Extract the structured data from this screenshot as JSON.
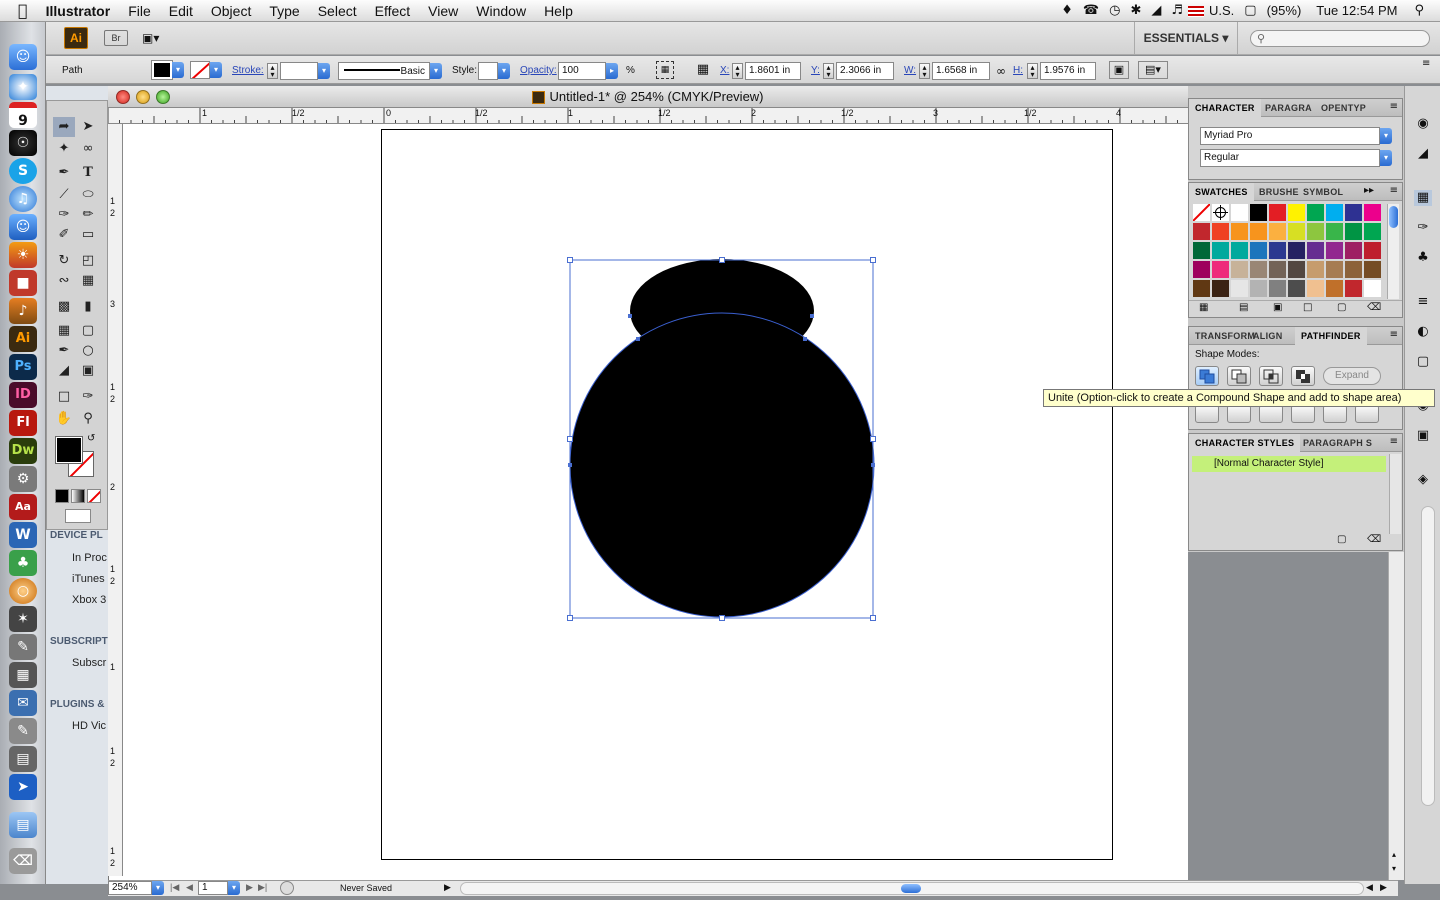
{
  "menubar": {
    "app_name": "Illustrator",
    "menus": [
      "File",
      "Edit",
      "Object",
      "Type",
      "Select",
      "Effect",
      "View",
      "Window",
      "Help"
    ],
    "input_locale": "U.S.",
    "battery": "(95%)",
    "clock": "Tue 12:54 PM"
  },
  "appbar": {
    "logo": "Ai",
    "bridge": "Br",
    "workspace": "ESSENTIALS"
  },
  "control": {
    "selection_type": "Path",
    "stroke_label": "Stroke:",
    "brush_label": "Basic",
    "style_label": "Style:",
    "opacity_label": "Opacity:",
    "opacity_value": "100",
    "opacity_unit": "%",
    "x_label": "X:",
    "x_value": "1.8601 in",
    "y_label": "Y:",
    "y_value": "2.3066 in",
    "w_label": "W:",
    "w_value": "1.6568 in",
    "h_label": "H:",
    "h_value": "1.9576 in"
  },
  "document": {
    "title": "Untitled-1* @ 254% (CMYK/Preview)"
  },
  "hruler_labels": [
    "1",
    "1/2",
    "0",
    "1/2",
    "1",
    "1/2",
    "2",
    "1/2",
    "3",
    "1/2",
    "4"
  ],
  "vruler_labels": [
    "1",
    "2",
    "3",
    "1",
    "2",
    "2",
    "1",
    "2",
    "1",
    "1",
    "2",
    "1",
    "2",
    "0"
  ],
  "status": {
    "zoom": "254%",
    "artboard_num": "1",
    "save_state": "Never Saved"
  },
  "sidebar_left": {
    "device_header": "DEVICE PL",
    "device_items": [
      "In Proc",
      "iTunes",
      "Xbox 3"
    ],
    "subs_header": "SUBSCRIPT",
    "subs_items": [
      "Subscr"
    ],
    "plugins_header": "PLUGINS &",
    "plugins_items": [
      "HD Vic"
    ]
  },
  "character_panel": {
    "tabs": [
      "CHARACTER",
      "PARAGRA",
      "OPENTYP"
    ],
    "font_family": "Myriad Pro",
    "font_style": "Regular"
  },
  "swatches_panel": {
    "tabs": [
      "SWATCHES",
      "BRUSHE",
      "SYMBOL"
    ],
    "colors": [
      "#ffffff",
      "#ffffff",
      "#ffffff",
      "#000000",
      "#e31e24",
      "#fff200",
      "#00a651",
      "#00aeef",
      "#2e3192",
      "#ec008c",
      "#c1272d",
      "#ef4123",
      "#f7941d",
      "#f7941d",
      "#fbb040",
      "#d7df23",
      "#8dc63f",
      "#39b54a",
      "#009444",
      "#00a651",
      "#006838",
      "#00a99d",
      "#00a99d",
      "#1c75bc",
      "#2b3990",
      "#262262",
      "#662d91",
      "#92278f",
      "#9e1f63",
      "#be1e2d",
      "#9e005d",
      "#ee2a7b",
      "#c7b299",
      "#998675",
      "#736357",
      "#534741",
      "#c69c6d",
      "#a67c52",
      "#8c6239",
      "#754c24",
      "#603813",
      "#3b2314",
      "#e6e6e6",
      "#b3b3b3",
      "#808080",
      "#4d4d4d",
      "#f0c090",
      "#c0702a",
      "#c1272d",
      "#ffffff"
    ]
  },
  "pathfinder_panel": {
    "tabs": [
      "TRANSFORM",
      "ALIGN",
      "PATHFINDER"
    ],
    "shape_modes_label": "Shape Modes:",
    "expand_label": "Expand"
  },
  "charstyles_panel": {
    "tabs": [
      "CHARACTER STYLES",
      "PARAGRAPH S"
    ],
    "item": "[Normal Character Style]"
  },
  "tooltip": "Unite (Option-click to create a Compound Shape and add to shape area)"
}
